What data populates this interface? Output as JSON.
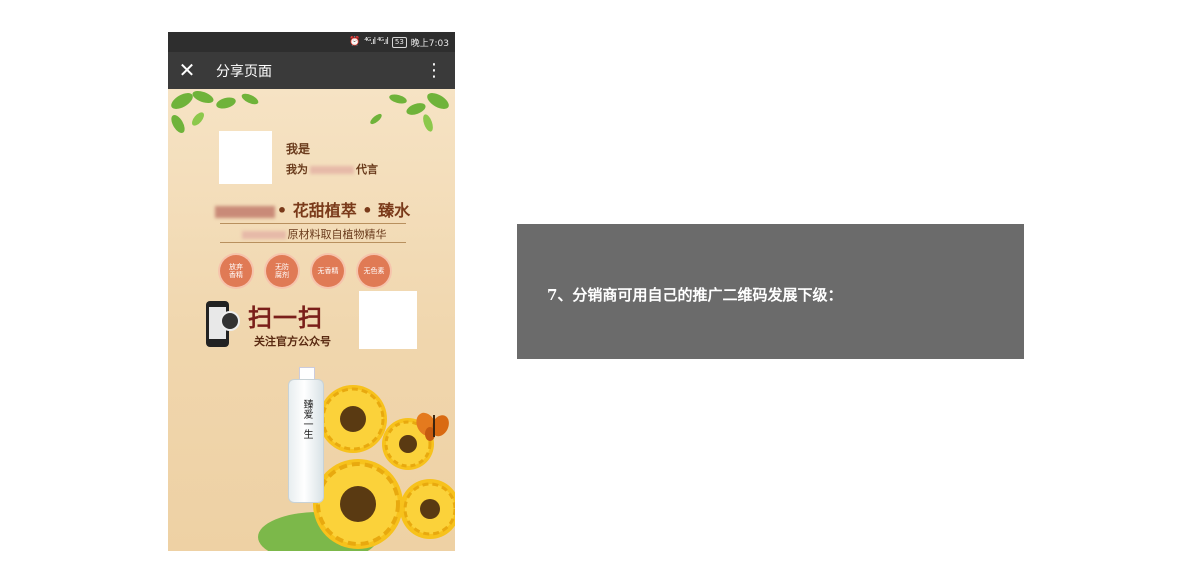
{
  "status_bar": {
    "signal": "⁴ᴳ.ıl ⁴ᴳ.ıl",
    "battery": "53",
    "time": "晚上7:03",
    "alarm_icon": "alarm-clock-icon"
  },
  "nav": {
    "close_label": "✕",
    "title": "分享页面",
    "more_label": "⋮"
  },
  "poster": {
    "i_am": "我是",
    "spokesperson_prefix": "我为",
    "spokesperson_suffix": "代言",
    "headline": "• 花甜植萃 • 臻水",
    "material_line": "原材料取自植物精华",
    "badges": [
      {
        "line1": "放弃",
        "line2": "香精"
      },
      {
        "line1": "无防",
        "line2": "腐剂"
      },
      {
        "line1": "无香精",
        "line2": ""
      },
      {
        "line1": "无色素",
        "line2": ""
      }
    ],
    "scan_label": "扫一扫",
    "follow_label": "关注官方公众号",
    "bottle_label": "臻爱一生"
  },
  "instruction": {
    "text": "7、分销商可用自己的推广二维码发展下级："
  },
  "colors": {
    "panel_bg": "#6b6b6b",
    "nav_bg": "#3a3a3a",
    "poster_bg": "#f3dcb9",
    "badge": "#e07a55"
  }
}
